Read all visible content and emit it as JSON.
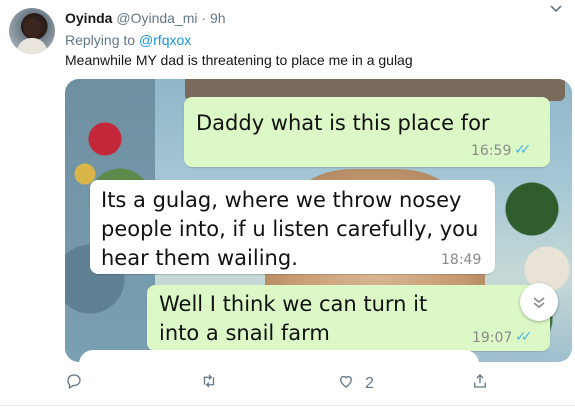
{
  "tweet": {
    "display_name": "Oyinda",
    "handle": "@Oyinda_mi",
    "separator": "·",
    "time": "9h",
    "replying_prefix": "Replying to",
    "replying_to": "@rfqxox",
    "text": "Meanwhile MY dad is threatening to place me in a gulag"
  },
  "chat": {
    "messages": [
      {
        "direction": "outgoing",
        "text": "Daddy what is this place for",
        "time": "16:59"
      },
      {
        "direction": "incoming",
        "text": "Its a gulag, where we throw nosey people into, if u listen carefully, you hear them wailing.",
        "time": "18:49"
      },
      {
        "direction": "outgoing",
        "text": "Well I think we can turn it into a snail farm",
        "time": "19:07"
      }
    ]
  },
  "actions": {
    "reply_count": "",
    "retweet_count": "",
    "like_count": "2"
  },
  "colors": {
    "link": "#1b95e0",
    "muted": "#657786",
    "outgoing_bubble": "#dcf8c6",
    "incoming_bubble": "#ffffff",
    "read_ticks": "#4fb6ec"
  },
  "icons": [
    "avatar",
    "chevron-down-icon",
    "reply-icon",
    "retweet-icon",
    "like-icon",
    "share-icon",
    "scroll-down-icon",
    "read-ticks-icon"
  ]
}
